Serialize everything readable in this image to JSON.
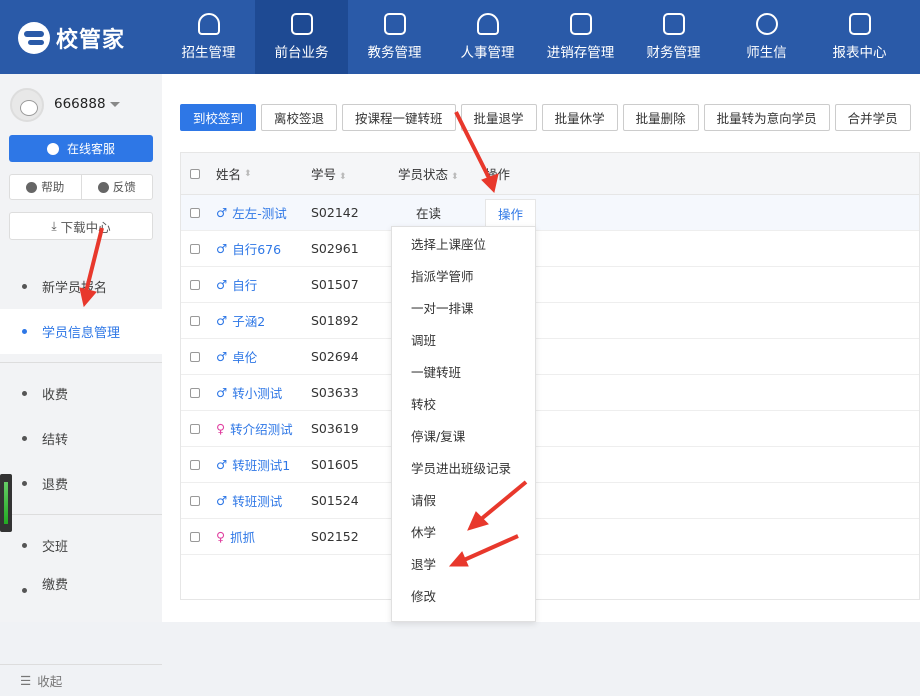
{
  "app": {
    "logo_text": "校管家"
  },
  "nav": [
    {
      "label": "招生管理",
      "icon": "person-add-icon"
    },
    {
      "label": "前台业务",
      "icon": "desk-icon"
    },
    {
      "label": "教务管理",
      "icon": "book-icon"
    },
    {
      "label": "人事管理",
      "icon": "person-icon"
    },
    {
      "label": "进销存管理",
      "icon": "inventory-icon"
    },
    {
      "label": "财务管理",
      "icon": "finance-icon"
    },
    {
      "label": "师生信",
      "icon": "chat-icon"
    },
    {
      "label": "报表中心",
      "icon": "chart-icon"
    }
  ],
  "nav_active_index": 1,
  "sidebar": {
    "username": "666888",
    "service_label": "在线客服",
    "help_label": "帮助",
    "feedback_label": "反馈",
    "download_label": "下载中心",
    "items": [
      {
        "label": "新学员报名"
      },
      {
        "label": "学员信息管理"
      },
      {
        "label": "收费"
      },
      {
        "label": "结转"
      },
      {
        "label": "退费"
      },
      {
        "label": "交班"
      },
      {
        "label": "缴费"
      }
    ],
    "collapse_label": "收起"
  },
  "toolbar": [
    {
      "label": "到校签到",
      "primary": true
    },
    {
      "label": "离校签退"
    },
    {
      "label": "按课程一键转班"
    },
    {
      "label": "批量退学"
    },
    {
      "label": "批量休学"
    },
    {
      "label": "批量删除"
    },
    {
      "label": "批量转为意向学员"
    },
    {
      "label": "合并学员"
    }
  ],
  "table": {
    "headers": {
      "name": "姓名",
      "id": "学号",
      "status": "学员状态",
      "op": "操作"
    },
    "rows": [
      {
        "gender": "male",
        "name": "左左-测试",
        "id": "S02142",
        "status": "在读",
        "op": "操作"
      },
      {
        "gender": "male",
        "name": "自行676",
        "id": "S02961",
        "status": "",
        "op": ""
      },
      {
        "gender": "male",
        "name": "自行",
        "id": "S01507",
        "status": "",
        "op": ""
      },
      {
        "gender": "male",
        "name": "子涵2",
        "id": "S01892",
        "status": "",
        "op": ""
      },
      {
        "gender": "male",
        "name": "卓伦",
        "id": "S02694",
        "status": "",
        "op": ""
      },
      {
        "gender": "male",
        "name": "转小测试",
        "id": "S03633",
        "status": "",
        "op": ""
      },
      {
        "gender": "female",
        "name": "转介绍测试",
        "id": "S03619",
        "status": "",
        "op": ""
      },
      {
        "gender": "male",
        "name": "转班测试1",
        "id": "S01605",
        "status": "",
        "op": ""
      },
      {
        "gender": "male",
        "name": "转班测试",
        "id": "S01524",
        "status": "",
        "op": ""
      },
      {
        "gender": "female",
        "name": "抓抓",
        "id": "S02152",
        "status": "",
        "op": ""
      }
    ]
  },
  "dropdown": [
    "选择上课座位",
    "指派学管师",
    "一对一排课",
    "调班",
    "一键转班",
    "转校",
    "停课/复课",
    "学员进出班级记录",
    "请假",
    "休学",
    "退学",
    "修改"
  ],
  "colors": {
    "topbar": "#2a5aa8",
    "accent": "#2e77e6",
    "arrow": "#e8382c"
  }
}
